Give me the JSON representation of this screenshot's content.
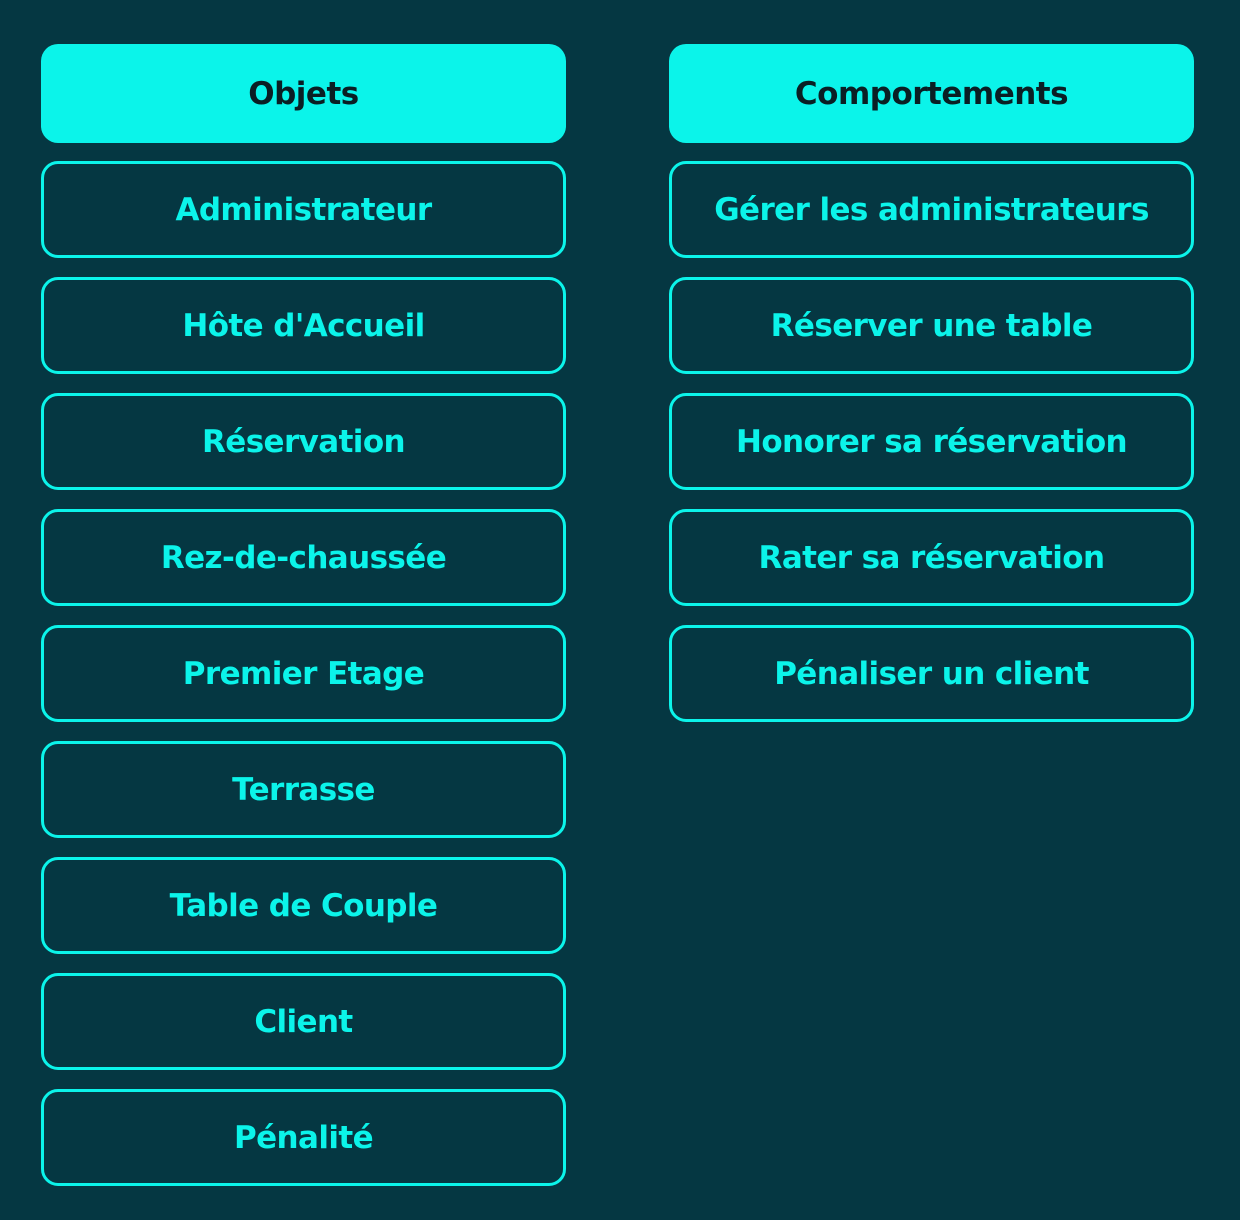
{
  "objects": {
    "header": "Objets",
    "items": [
      "Administrateur",
      "Hôte d'Accueil",
      "Réservation",
      "Rez-de-chaussée",
      "Premier Etage",
      "Terrasse",
      "Table de Couple",
      "Client",
      "Pénalité"
    ]
  },
  "behaviors": {
    "header": "Comportements",
    "items": [
      "Gérer les administrateurs",
      "Réserver une table",
      "Honorer sa réservation",
      "Rater sa réservation",
      "Pénaliser un client"
    ]
  },
  "colors": {
    "background": "#053742",
    "accent": "#0BF4EA",
    "header_text": "#0A1F24"
  }
}
